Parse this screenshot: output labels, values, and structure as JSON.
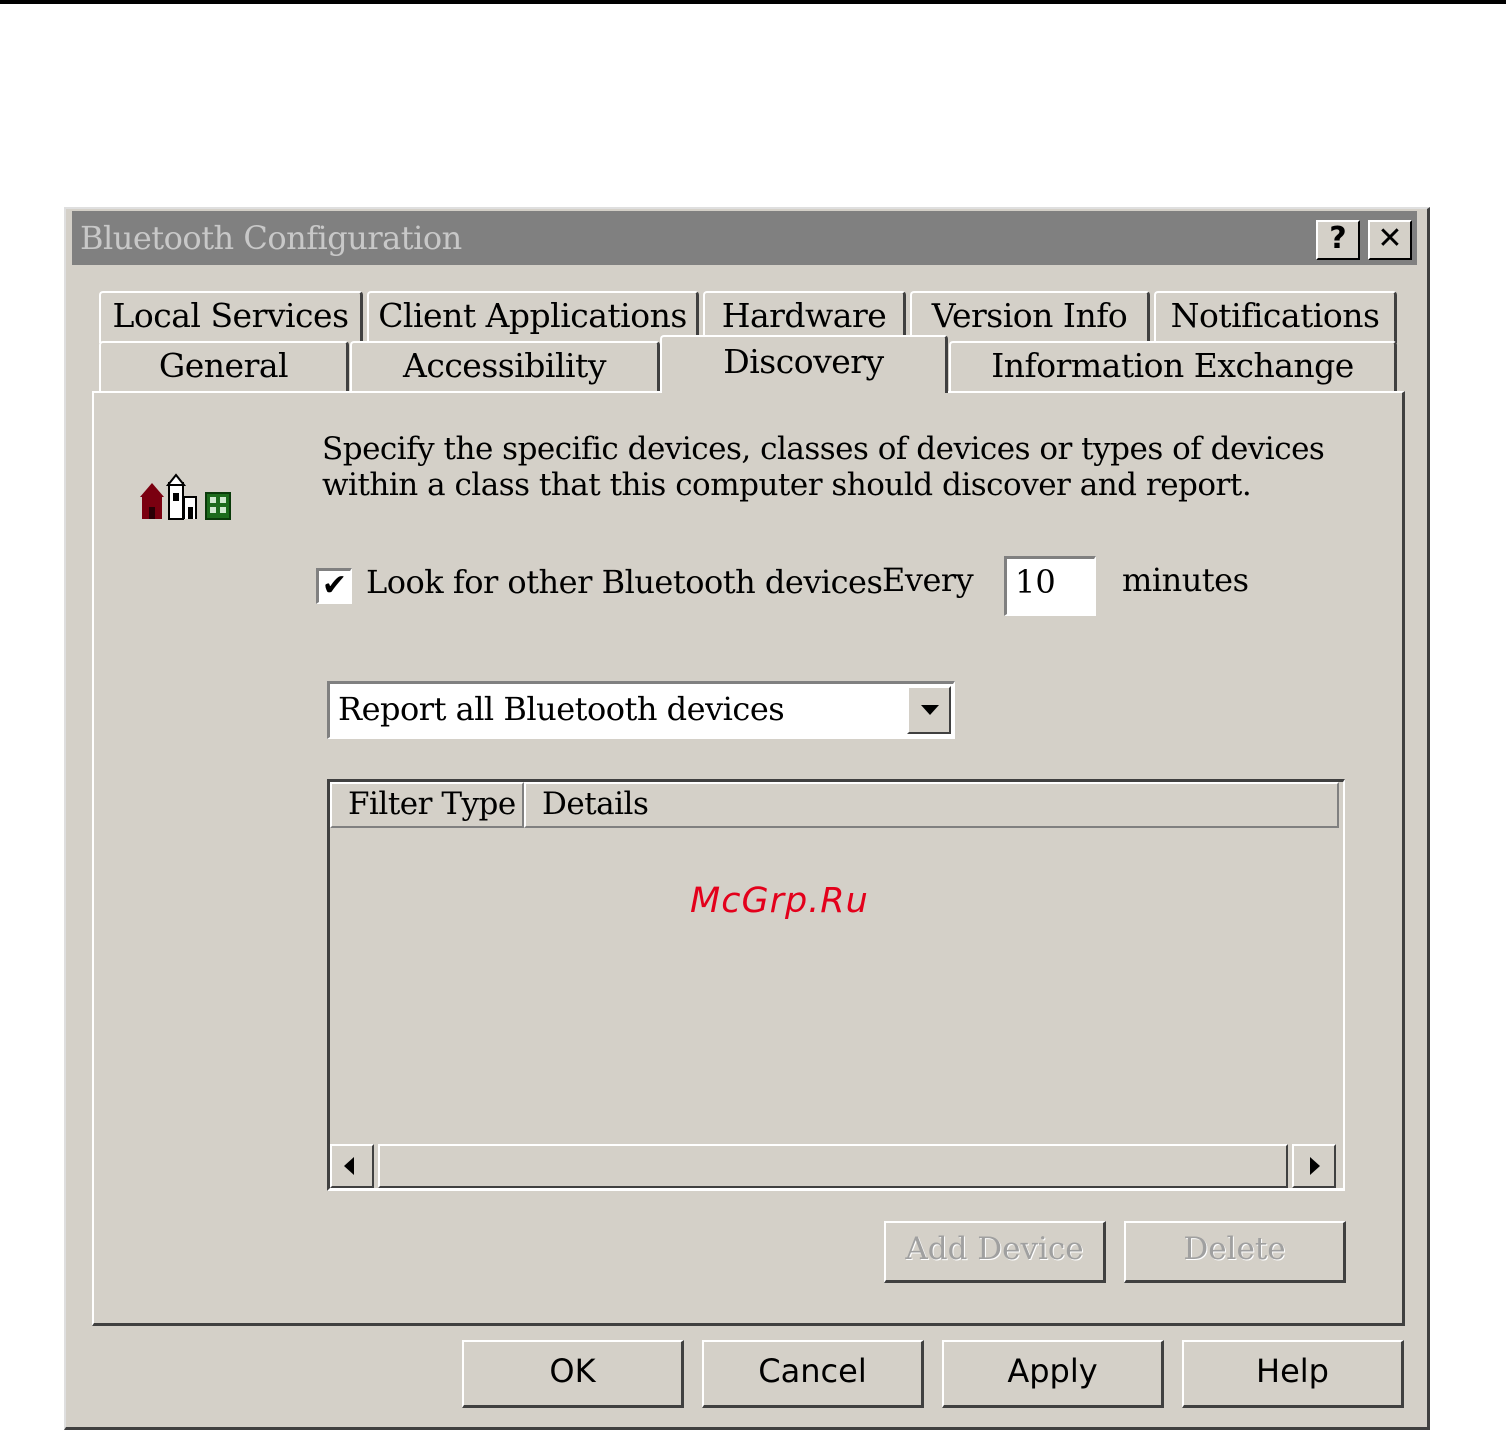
{
  "window": {
    "title": "Bluetooth Configuration",
    "help_button": "?",
    "close_button": "✕"
  },
  "tabs": {
    "row1": [
      "Local Services",
      "Client Applications",
      "Hardware",
      "Version Info",
      "Notifications"
    ],
    "row2": [
      "General",
      "Accessibility",
      "Discovery",
      "Information Exchange"
    ],
    "active": "Discovery"
  },
  "discovery": {
    "icon": "devices-icon",
    "description": "Specify the specific devices, classes of devices or types of devices within a class that this computer should discover and report.",
    "look_checkbox_checked": true,
    "look_label": "Look for other Bluetooth devices",
    "every_label": "Every",
    "interval_value": "10",
    "minutes_label": "minutes",
    "report_select_value": "Report all Bluetooth devices",
    "filter_columns": [
      "Filter Type",
      "Details"
    ],
    "filter_rows": [],
    "add_device_label": "Add Device",
    "delete_label": "Delete"
  },
  "footer": {
    "ok_label": "OK",
    "cancel_label": "Cancel",
    "apply_label": "Apply",
    "help_label": "Help"
  },
  "watermark": "McGrp.Ru",
  "colors": {
    "face": "#d4d0c8",
    "titlebar_inactive": "#808080",
    "watermark": "#e3001b"
  }
}
